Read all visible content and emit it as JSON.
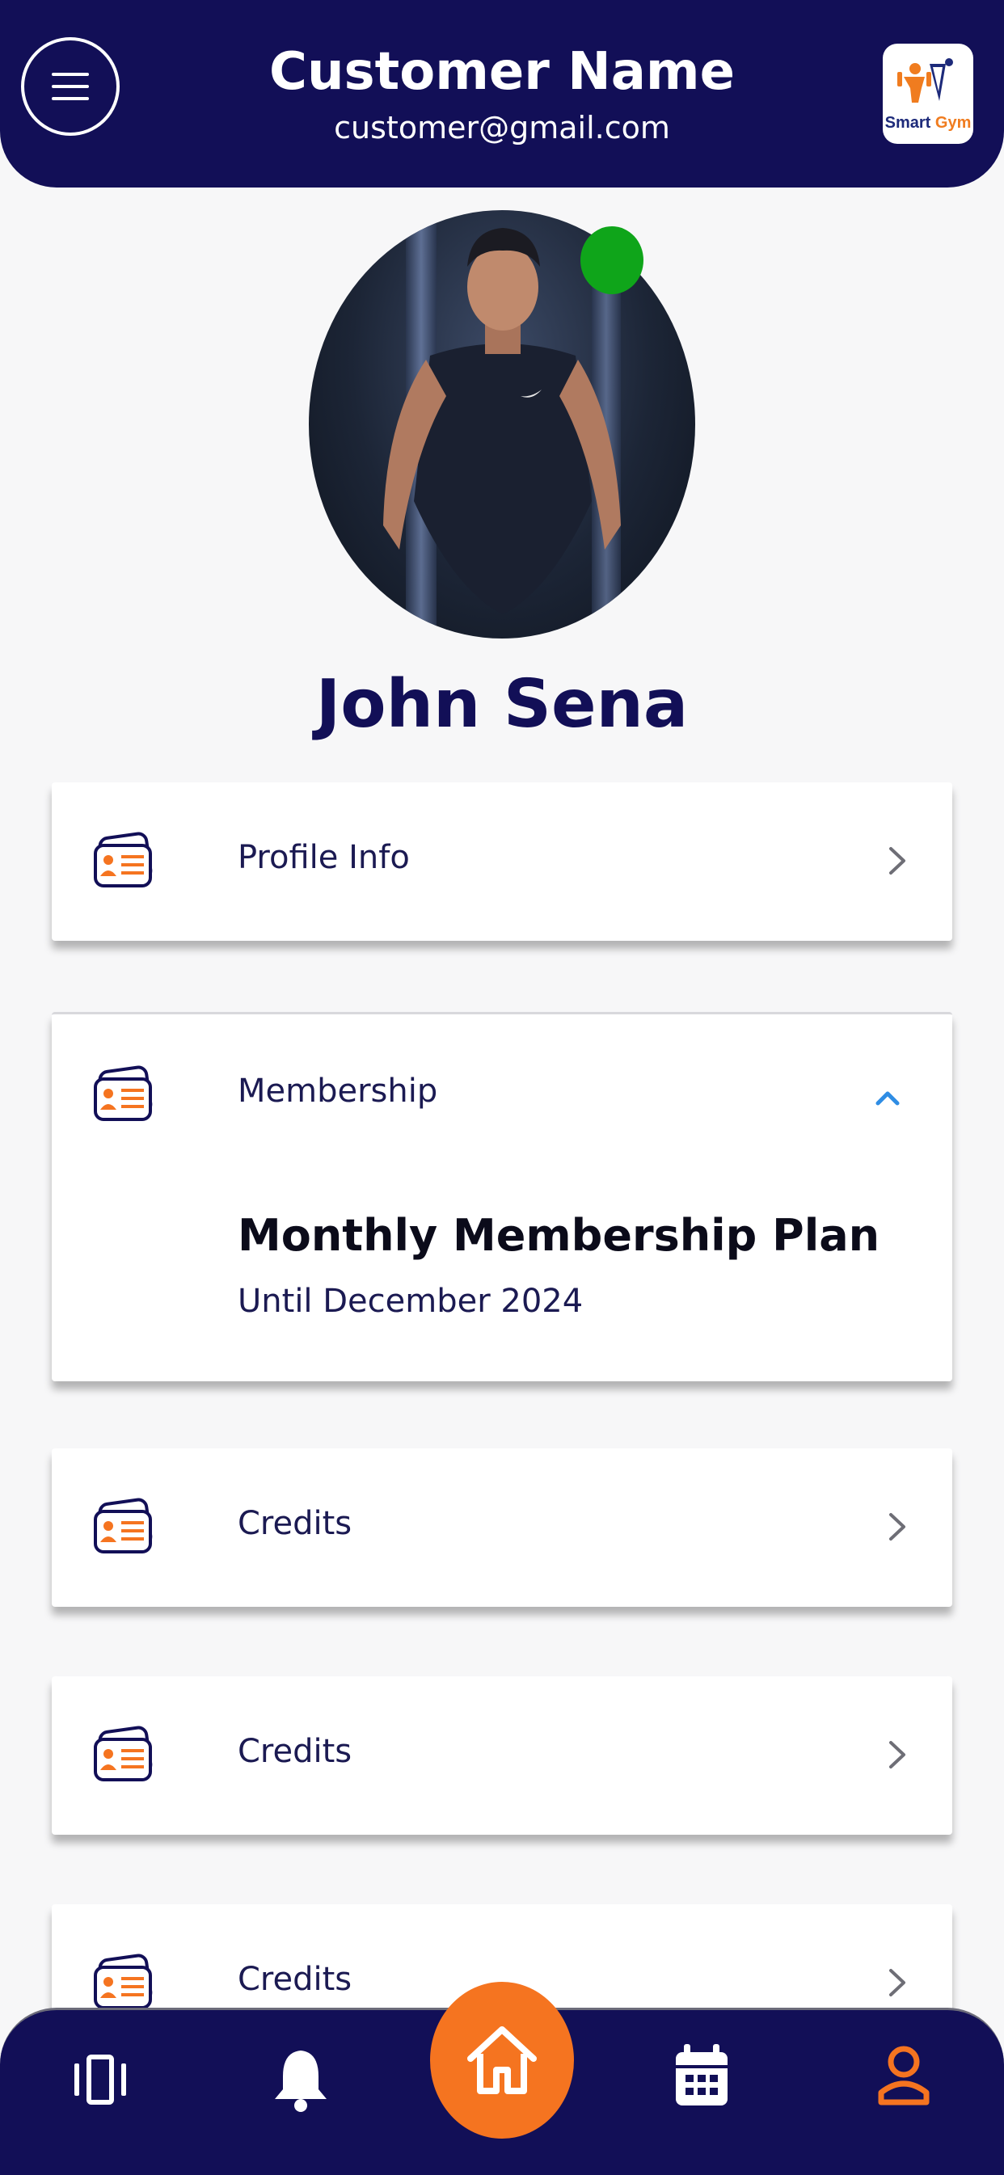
{
  "header": {
    "title": "Customer Name",
    "email": "customer@gmail.com",
    "logo": {
      "word1": "Smart",
      "word2": "Gym"
    }
  },
  "profile": {
    "name": "John Sena",
    "status": "online"
  },
  "menu": [
    {
      "label": "Profile Info",
      "state": "collapsed",
      "icon": "id-card-icon"
    },
    {
      "label": "Membership",
      "state": "expanded",
      "icon": "id-card-icon",
      "plan": {
        "title": "Monthly Membership Plan",
        "subtitle": "Until December 2024"
      }
    },
    {
      "label": "Credits",
      "state": "collapsed",
      "icon": "id-card-icon"
    },
    {
      "label": "Credits",
      "state": "collapsed",
      "icon": "id-card-icon"
    },
    {
      "label": "Credits",
      "state": "collapsed",
      "icon": "id-card-icon"
    }
  ],
  "bottom_nav": {
    "items": [
      "carousel-icon",
      "bell-icon",
      "home-icon",
      "calendar-icon",
      "user-icon"
    ],
    "active": "user-icon"
  },
  "colors": {
    "primary": "#120f57",
    "accent": "#f57420",
    "online": "#0fa51a",
    "expanded_chevron": "#2f8de4"
  }
}
